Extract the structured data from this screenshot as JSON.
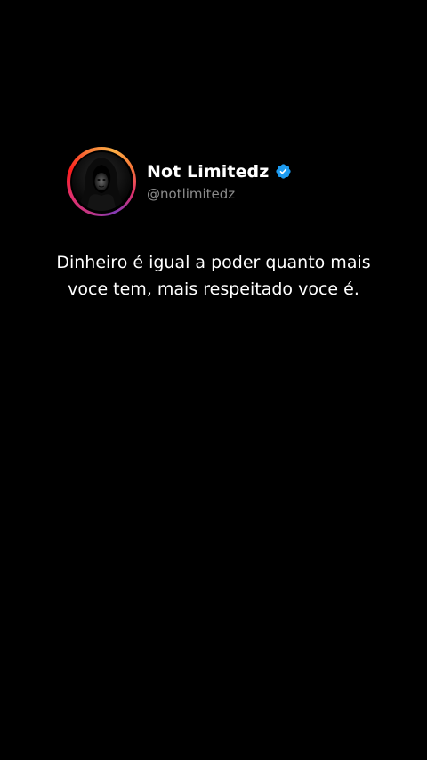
{
  "profile": {
    "display_name": "Not Limitedz",
    "handle": "@notlimitedz",
    "verified_icon": "verified-badge-icon",
    "avatar_icon": "hooded-figure-avatar"
  },
  "tweet": {
    "line1": "Dinheiro é igual a poder quanto mais",
    "line2": "voce tem, mais respeitado voce é."
  },
  "colors": {
    "background": "#000000",
    "text": "#ffffff",
    "handle": "#8b8b8b",
    "verified": "#1d9bf0",
    "ring_gradient": [
      "#833ab4",
      "#c13584",
      "#e1306c",
      "#fd1d1d",
      "#f77737",
      "#fcaf45"
    ]
  }
}
